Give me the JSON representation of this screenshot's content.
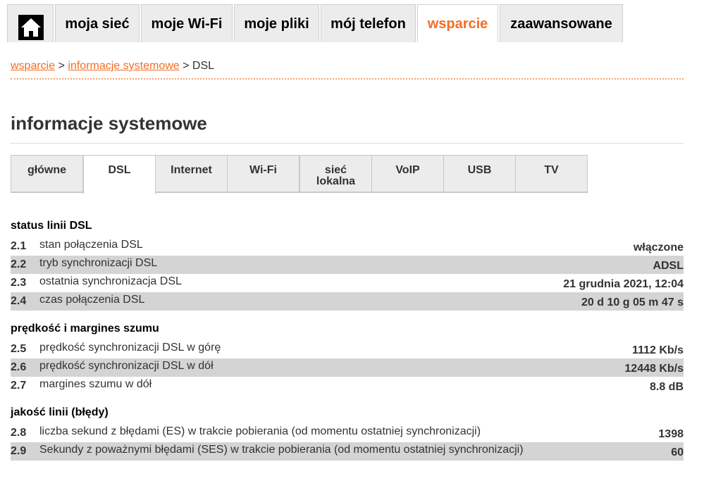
{
  "nav": {
    "home_icon": "home-icon",
    "tabs": [
      {
        "label": "moja sieć"
      },
      {
        "label": "moje Wi-Fi"
      },
      {
        "label": "moje pliki"
      },
      {
        "label": "mój telefon"
      },
      {
        "label": "wsparcie",
        "active": true
      },
      {
        "label": "zaawansowane"
      }
    ]
  },
  "breadcrumb": {
    "item1": "wsparcie",
    "sep1": ">",
    "item2": "informacje systemowe",
    "sep2": ">",
    "current": "DSL"
  },
  "page_title": "informacje systemowe",
  "subtabs": [
    {
      "label": "główne"
    },
    {
      "label": "DSL",
      "active": true
    },
    {
      "label": "Internet"
    },
    {
      "label": "Wi-Fi"
    },
    {
      "label_line1": "sieć",
      "label_line2": "lokalna"
    },
    {
      "label": "VoIP"
    },
    {
      "label": "USB"
    },
    {
      "label": "TV"
    }
  ],
  "sections": [
    {
      "title": "status linii DSL",
      "rows": [
        {
          "num": "2.1",
          "label": "stan połączenia DSL",
          "value": "włączone"
        },
        {
          "num": "2.2",
          "label": "tryb synchronizacji DSL",
          "value": "ADSL"
        },
        {
          "num": "2.3",
          "label": "ostatnia synchronizacja DSL",
          "value": "21 grudnia 2021, 12:04"
        },
        {
          "num": "2.4",
          "label": "czas połączenia DSL",
          "value": "20 d 10 g 05 m 47 s"
        }
      ]
    },
    {
      "title": "prędkość i margines szumu",
      "rows": [
        {
          "num": "2.5",
          "label": "prędkość synchronizacji DSL w górę",
          "value": "1112 Kb/s"
        },
        {
          "num": "2.6",
          "label": "prędkość synchronizacji DSL w dół",
          "value": "12448 Kb/s"
        },
        {
          "num": "2.7",
          "label": "margines szumu w dół",
          "value": "8.8 dB"
        }
      ]
    },
    {
      "title": "jakość linii (błędy)",
      "rows": [
        {
          "num": "2.8",
          "label": "liczba sekund z błędami (ES) w trakcie pobierania (od momentu ostatniej synchronizacji)",
          "value": "1398"
        },
        {
          "num": "2.9",
          "label": "Sekundy z poważnymi błędami (SES) w trakcie pobierania (od momentu ostatniej synchronizacji)",
          "value": "60"
        }
      ]
    }
  ],
  "colors": {
    "accent": "#f16e23",
    "row_shade": "#d4d4d4",
    "tab_bg": "#ececec"
  }
}
